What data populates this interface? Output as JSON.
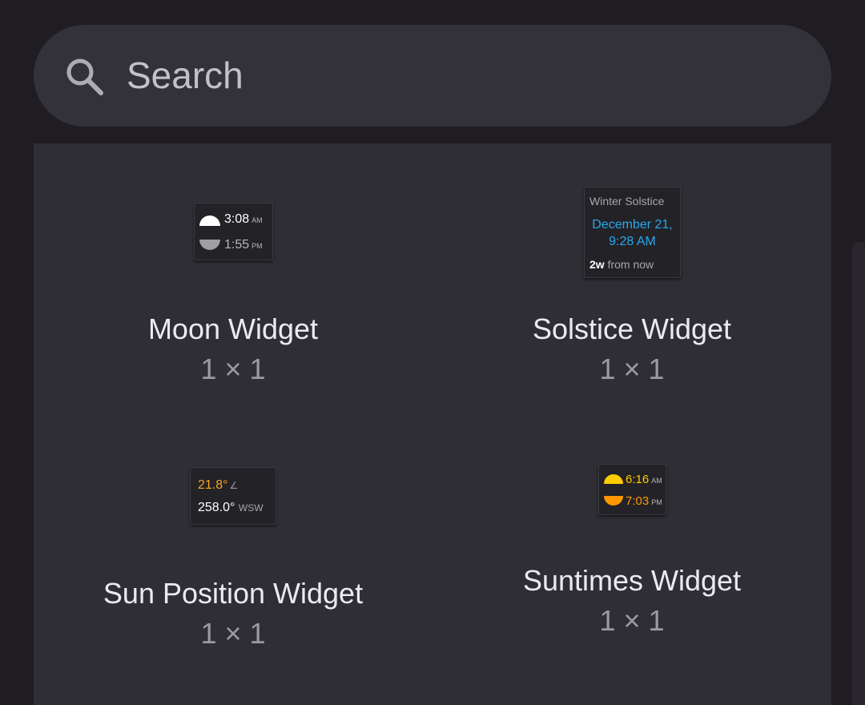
{
  "search": {
    "placeholder": "Search"
  },
  "widgets": [
    {
      "title": "Moon Widget",
      "size": "1 × 1",
      "preview": {
        "rise_time": "3:08",
        "rise_ampm": "AM",
        "set_time": "1:55",
        "set_ampm": "PM"
      }
    },
    {
      "title": "Solstice Widget",
      "size": "1 × 1",
      "preview": {
        "event": "Winter Solstice",
        "date": "December 21,",
        "time": "9:28 AM",
        "countdown": "2w",
        "countdown_suffix": "from now"
      }
    },
    {
      "title": "Sun Position Widget",
      "size": "1 × 1",
      "preview": {
        "elevation": "21.8°",
        "elevation_symbol": "∠",
        "azimuth": "258.0°",
        "direction": "WSW"
      }
    },
    {
      "title": "Suntimes Widget",
      "size": "1 × 1",
      "preview": {
        "sunrise_time": "6:16",
        "sunrise_ampm": "AM",
        "sunset_time": "7:03",
        "sunset_ampm": "PM"
      }
    }
  ],
  "colors": {
    "accent_blue": "#29a8ec",
    "sun_yellow": "#ffcc00",
    "sun_orange": "#ff9800",
    "elevation_orange": "#f5a623"
  }
}
